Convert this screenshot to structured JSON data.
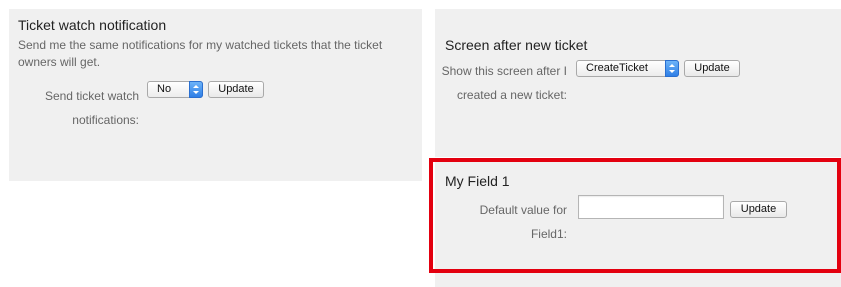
{
  "ticket_watch": {
    "title": "Ticket watch notification",
    "description": "Send me the same notifications for my watched tickets that the ticket owners will get.",
    "field_label": "Send ticket watch notifications:",
    "select_value": "No",
    "update_label": "Update"
  },
  "screen_after": {
    "title": "Screen after new ticket",
    "field_label": "Show this screen after I created a new ticket:",
    "select_value": "CreateTicket",
    "update_label": "Update"
  },
  "my_field": {
    "title": "My Field 1",
    "field_label": "Default value for Field1:",
    "input_value": "",
    "update_label": "Update"
  },
  "colors": {
    "panel_background": "#f0f0f0",
    "highlight_border": "#e3000f",
    "select_arrow": "#2f7fe6"
  }
}
